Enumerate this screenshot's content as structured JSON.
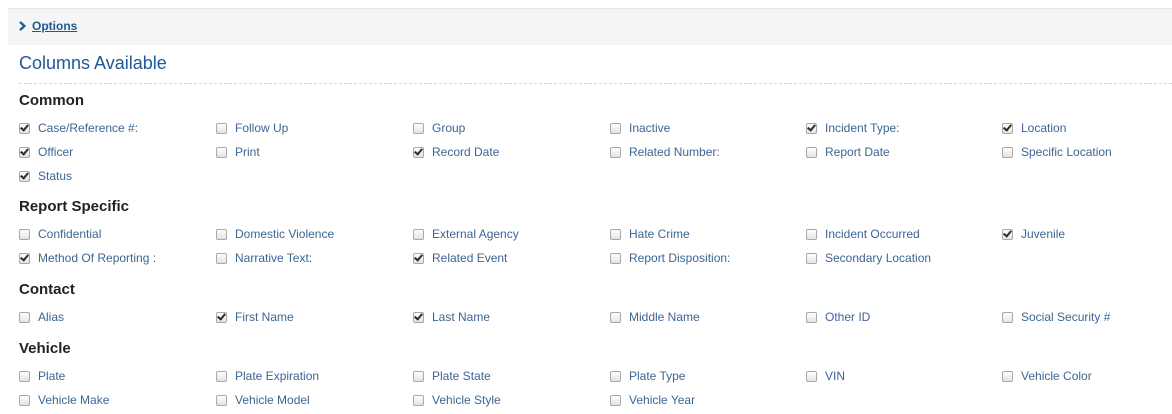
{
  "options": {
    "label": "Options"
  },
  "panel_title": "Columns Available",
  "sections": [
    {
      "title": "Common",
      "items": [
        {
          "label": "Case/Reference #:",
          "checked": true
        },
        {
          "label": "Follow Up",
          "checked": false
        },
        {
          "label": "Group",
          "checked": false
        },
        {
          "label": "Inactive",
          "checked": false
        },
        {
          "label": "Incident Type:",
          "checked": true
        },
        {
          "label": "Location",
          "checked": true
        },
        {
          "label": "Officer",
          "checked": true
        },
        {
          "label": "Print",
          "checked": false
        },
        {
          "label": "Record Date",
          "checked": true
        },
        {
          "label": "Related Number:",
          "checked": false
        },
        {
          "label": "Report Date",
          "checked": false
        },
        {
          "label": "Specific Location",
          "checked": false
        },
        {
          "label": "Status",
          "checked": true
        }
      ]
    },
    {
      "title": "Report Specific",
      "items": [
        {
          "label": "Confidential",
          "checked": false
        },
        {
          "label": "Domestic Violence",
          "checked": false
        },
        {
          "label": "External Agency",
          "checked": false
        },
        {
          "label": "Hate Crime",
          "checked": false
        },
        {
          "label": "Incident Occurred",
          "checked": false
        },
        {
          "label": "Juvenile",
          "checked": true
        },
        {
          "label": "Method Of Reporting :",
          "checked": true
        },
        {
          "label": "Narrative Text:",
          "checked": false
        },
        {
          "label": "Related Event",
          "checked": true
        },
        {
          "label": "Report Disposition:",
          "checked": false
        },
        {
          "label": "Secondary Location",
          "checked": false
        }
      ]
    },
    {
      "title": "Contact",
      "items": [
        {
          "label": "Alias",
          "checked": false
        },
        {
          "label": "First Name",
          "checked": true
        },
        {
          "label": "Last Name",
          "checked": true
        },
        {
          "label": "Middle Name",
          "checked": false
        },
        {
          "label": "Other ID",
          "checked": false
        },
        {
          "label": "Social Security #",
          "checked": false
        }
      ]
    },
    {
      "title": "Vehicle",
      "items": [
        {
          "label": "Plate",
          "checked": false
        },
        {
          "label": "Plate Expiration",
          "checked": false
        },
        {
          "label": "Plate State",
          "checked": false
        },
        {
          "label": "Plate Type",
          "checked": false
        },
        {
          "label": "VIN",
          "checked": false
        },
        {
          "label": "Vehicle Color",
          "checked": false
        },
        {
          "label": "Vehicle Make",
          "checked": false
        },
        {
          "label": "Vehicle Model",
          "checked": false
        },
        {
          "label": "Vehicle Style",
          "checked": false
        },
        {
          "label": "Vehicle Year",
          "checked": false
        }
      ]
    }
  ]
}
